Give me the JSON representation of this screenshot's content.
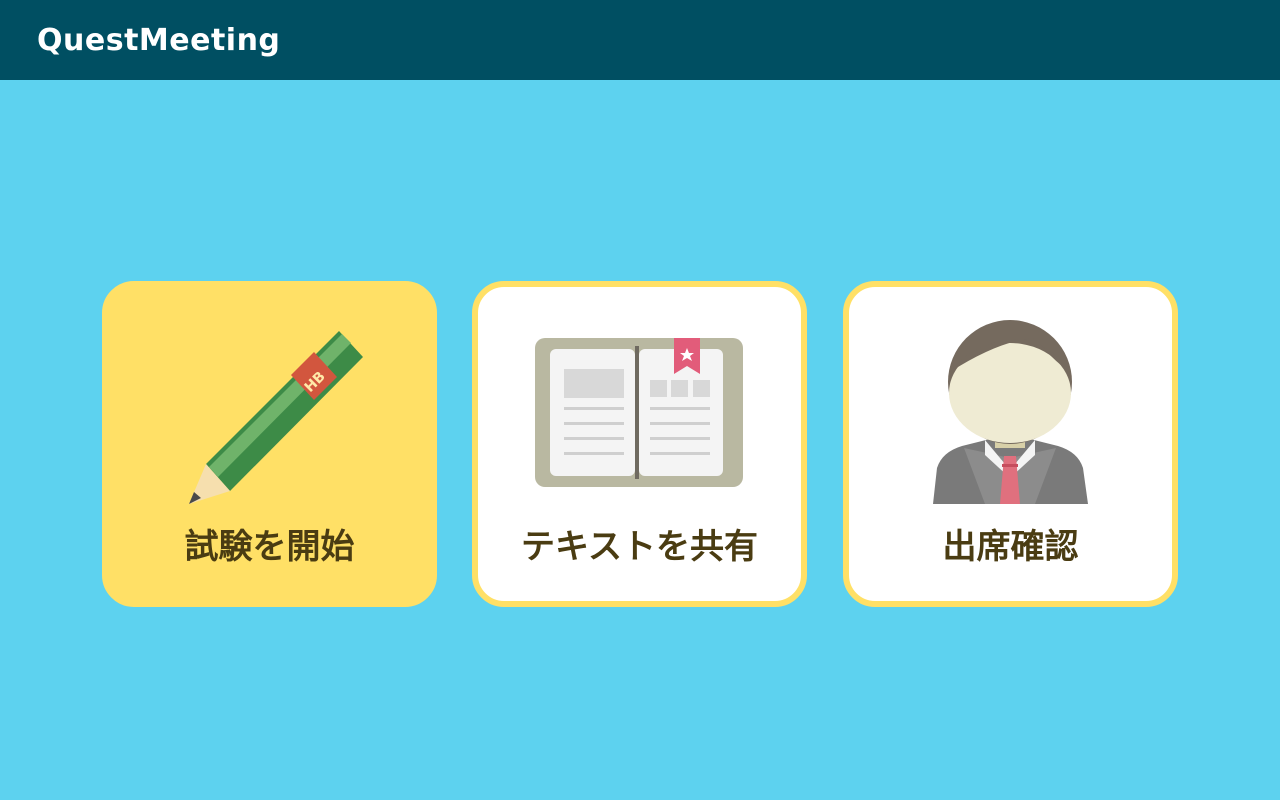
{
  "app": {
    "title": "QuestMeeting"
  },
  "colors": {
    "header_bg": "#004f62",
    "page_bg": "#5dd2ef",
    "card_border": "#ffe066",
    "card_active_bg": "#ffe066",
    "card_bg": "#ffffff",
    "label_text": "#4a3c12"
  },
  "menu": {
    "cards": [
      {
        "label": "試験を開始",
        "icon": "pencil-icon",
        "active": true
      },
      {
        "label": "テキストを共有",
        "icon": "open-book-icon",
        "active": false
      },
      {
        "label": "出席確認",
        "icon": "person-icon",
        "active": false
      }
    ]
  },
  "pencil": {
    "grade": "HB"
  }
}
